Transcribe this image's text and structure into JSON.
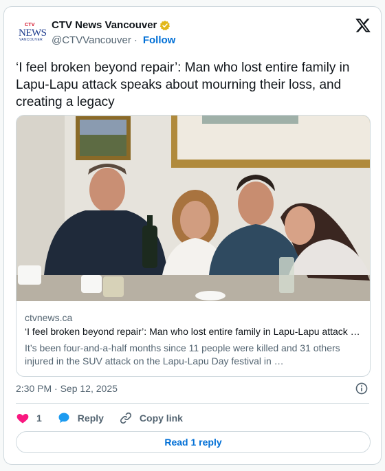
{
  "account": {
    "display_name": "CTV News Vancouver",
    "handle": "@CTVVancouver",
    "separator": "·",
    "follow_label": "Follow",
    "logo": {
      "ctv": "CTV",
      "news": "NEWS",
      "city": "VANCOUVER"
    },
    "verified_badge_color": "#e2b719"
  },
  "tweet": {
    "text": "‘I feel broken beyond repair’: Man who lost entire family in Lapu-Lapu attack speaks about mourning their loss, and creating a legacy"
  },
  "link_card": {
    "domain": "ctvnews.ca",
    "title": "‘I feel broken beyond repair’: Man who lost entire family in Lapu-Lapu attack speaks about mourning their loss, and creating a legacy",
    "description": "It’s been four-and-a-half months since 11 people were killed and 31 others injured in the SUV attack on the Lapu-Lapu Day festival in …",
    "photo_alt": "Family photo of four people seated at a dinner table"
  },
  "meta": {
    "time": "2:30 PM",
    "separator": "·",
    "date": "Sep 12, 2025"
  },
  "actions": {
    "like_count": "1",
    "reply_label": "Reply",
    "copy_link_label": "Copy link"
  },
  "read_reply_label": "Read 1 reply",
  "colors": {
    "accent": "#006fd6",
    "like": "#f91880",
    "reply": "#1d9bf0",
    "muted": "#536471"
  }
}
